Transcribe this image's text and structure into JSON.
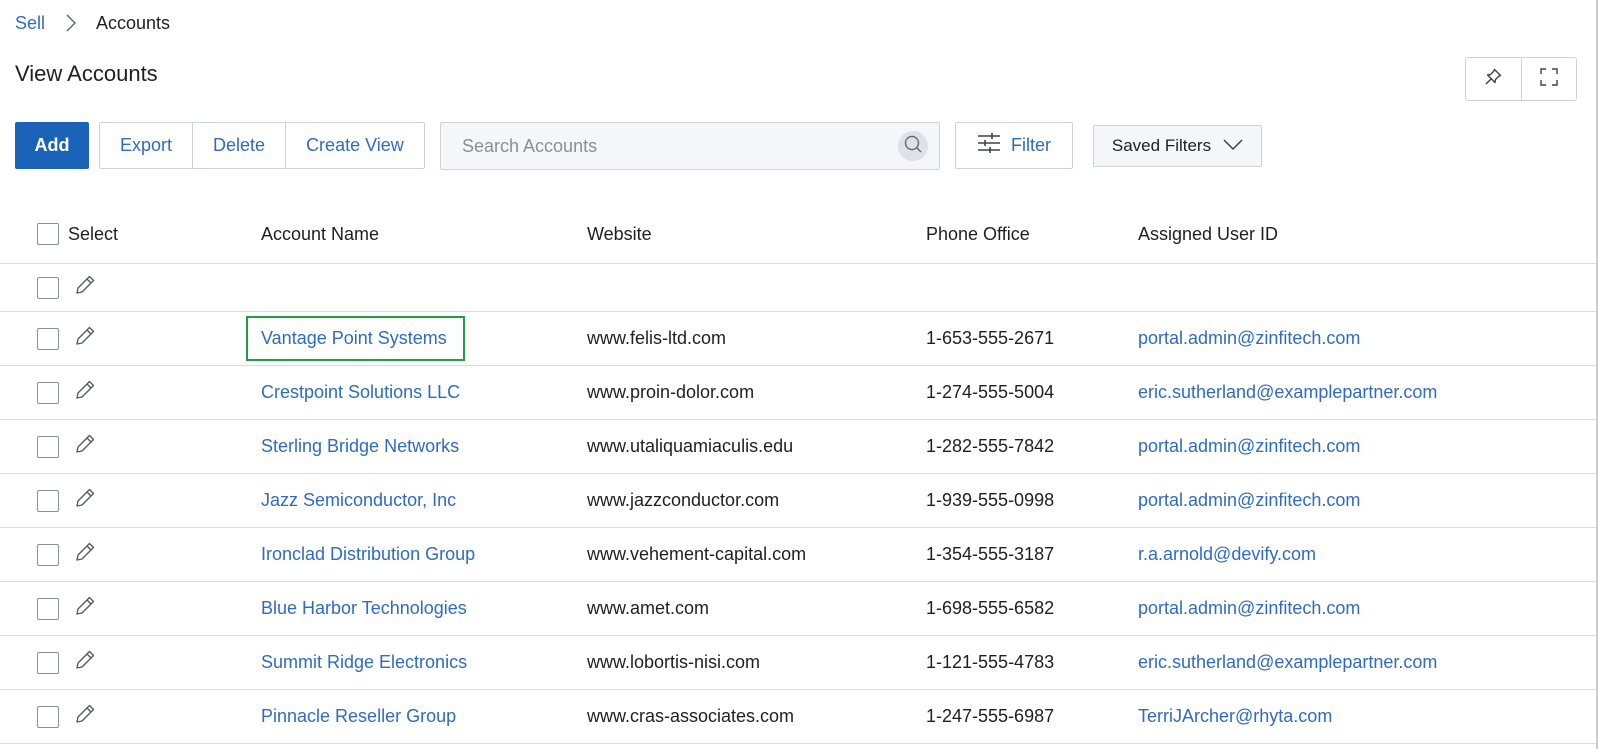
{
  "breadcrumb": {
    "parent": "Sell",
    "current": "Accounts"
  },
  "page": {
    "title": "View Accounts"
  },
  "toolbar": {
    "add_label": "Add",
    "export_label": "Export",
    "delete_label": "Delete",
    "create_view_label": "Create View",
    "filter_label": "Filter",
    "saved_filters_label": "Saved Filters"
  },
  "search": {
    "placeholder": "Search Accounts",
    "value": ""
  },
  "icons": {
    "pin": "pin-icon",
    "fullscreen": "fullscreen-icon",
    "search": "search-icon",
    "filter": "sliders-icon",
    "dropdown": "chevron-down-icon",
    "edit": "pencil-icon",
    "breadcrumb_separator": "chevron-right-icon"
  },
  "colors": {
    "primary": "#1b63b8",
    "link": "#2f6bc2",
    "highlight": "#1e9e45"
  },
  "table": {
    "columns": {
      "select": "Select",
      "name": "Account Name",
      "website": "Website",
      "phone": "Phone Office",
      "user": "Assigned User ID"
    },
    "rows": [
      {
        "name": "Vantage Point Systems",
        "website": "www.felis-ltd.com",
        "phone": "1-653-555-2671",
        "user": "portal.admin@zinfitech.com"
      },
      {
        "name": "Crestpoint Solutions LLC",
        "website": "www.proin-dolor.com",
        "phone": "1-274-555-5004",
        "user": "eric.sutherland@examplepartner.com"
      },
      {
        "name": "Sterling Bridge Networks",
        "website": "www.utaliquamiaculis.edu",
        "phone": "1-282-555-7842",
        "user": "portal.admin@zinfitech.com"
      },
      {
        "name": "Jazz Semiconductor, Inc",
        "website": "www.jazzconductor.com",
        "phone": "1-939-555-0998",
        "user": "portal.admin@zinfitech.com"
      },
      {
        "name": "Ironclad Distribution Group",
        "website": "www.vehement-capital.com",
        "phone": "1-354-555-3187",
        "user": "r.a.arnold@devify.com"
      },
      {
        "name": "Blue Harbor Technologies",
        "website": "www.amet.com",
        "phone": "1-698-555-6582",
        "user": "portal.admin@zinfitech.com"
      },
      {
        "name": "Summit Ridge Electronics",
        "website": "www.lobortis-nisi.com",
        "phone": "1-121-555-4783",
        "user": "eric.sutherland@examplepartner.com"
      },
      {
        "name": "Pinnacle Reseller Group",
        "website": "www.cras-associates.com",
        "phone": "1-247-555-6987",
        "user": "TerriJArcher@rhyta.com"
      }
    ]
  }
}
